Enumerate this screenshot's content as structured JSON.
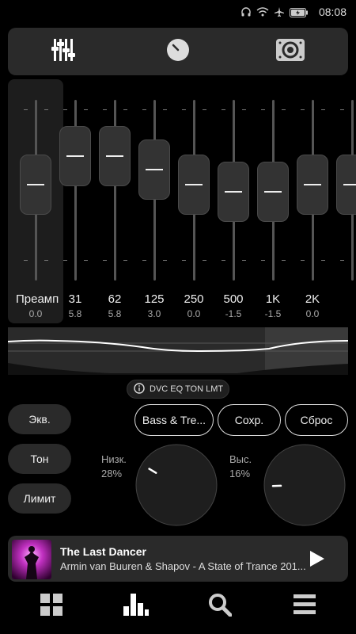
{
  "status_bar": {
    "time": "08:08",
    "icons": [
      "headphones-icon",
      "wifi-icon",
      "airplane-mode-icon",
      "battery-charging-icon"
    ]
  },
  "tabs": [
    {
      "name": "equalizer-tab",
      "icon": "sliders-icon",
      "active": true
    },
    {
      "name": "volume-tab",
      "icon": "knob-icon",
      "active": false
    },
    {
      "name": "speaker-tab",
      "icon": "speaker-icon",
      "active": false
    }
  ],
  "eq": {
    "bands": [
      {
        "label": "Преамп",
        "value": "0.0"
      },
      {
        "label": "31",
        "value": "5.8"
      },
      {
        "label": "62",
        "value": "5.8"
      },
      {
        "label": "125",
        "value": "3.0"
      },
      {
        "label": "250",
        "value": "0.0"
      },
      {
        "label": "500",
        "value": "-1.5"
      },
      {
        "label": "1K",
        "value": "-1.5"
      },
      {
        "label": "2K",
        "value": "0.0"
      },
      {
        "label": "",
        "value": ""
      }
    ]
  },
  "info": {
    "text": "DVC EQ TON LMT",
    "icon": "info-icon"
  },
  "mode_buttons": {
    "eq": "Экв.",
    "tone": "Тон",
    "limit": "Лимит"
  },
  "action_buttons": {
    "preset": "Bass & Tre...",
    "save": "Сохр.",
    "reset": "Сброс"
  },
  "tone": {
    "bass_label": "Низк.",
    "bass_value": "28%",
    "treble_label": "Выс.",
    "treble_value": "16%",
    "bass_level": 0.28,
    "treble_level": 0.16
  },
  "now_playing": {
    "title": "The Last Dancer",
    "artist": "Armin van Buuren & Shapov - A State of Trance 201..."
  },
  "bottom_nav": [
    "grid-icon",
    "bars-chart-icon",
    "search-icon",
    "menu-icon"
  ],
  "colors": {
    "background": "#000000",
    "panel": "#2a2a2a",
    "accent": "#ffffff"
  }
}
